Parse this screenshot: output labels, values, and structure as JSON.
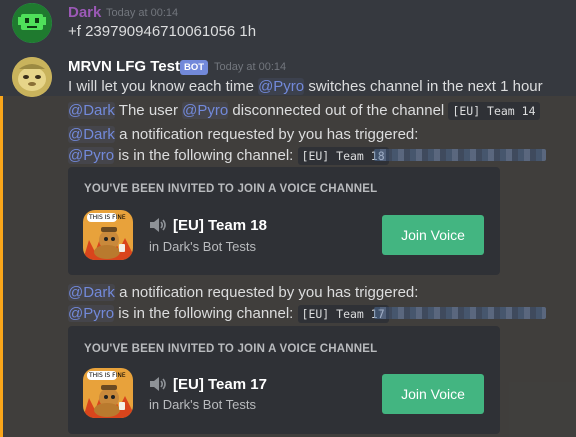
{
  "messages": {
    "first": {
      "author": "Dark",
      "timestamp": "Today at 00:14",
      "text": "+f 239790946710061056 1h"
    },
    "second": {
      "author": "MRVN LFG Tests",
      "badge": "BOT",
      "timestamp": "Today at 00:14",
      "line1_pre": "I will let you know each time ",
      "line1_mention": "@Pyro",
      "line1_post": " switches channel in the next 1 hour",
      "line2_mention": "@Dark",
      "line2_mid": " The user ",
      "line2_mention2": "@Pyro",
      "line2_post": " disconnected out of the channel ",
      "line2_code": "[EU] Team 14",
      "notif1_mention": "@Dark",
      "notif1_text": " a notification requested by you has triggered:",
      "notif1b_mention": "@Pyro",
      "notif1b_text": " is in the following channel: ",
      "notif1b_code": "[EU] Team 18",
      "notif2_mention": "@Dark",
      "notif2_text": " a notification requested by you has triggered:",
      "notif2b_mention": "@Pyro",
      "notif2b_text": " is in the following channel: ",
      "notif2b_code": "[EU] Team 17"
    }
  },
  "invites": [
    {
      "title": "You've been invited to join a voice channel",
      "channel": "[EU] Team 18",
      "guild": "in Dark's Bot Tests",
      "button": "Join Voice",
      "icon_caption": "THIS IS FINE"
    },
    {
      "title": "You've been invited to join a voice channel",
      "channel": "[EU] Team 17",
      "guild": "in Dark's Bot Tests",
      "button": "Join Voice",
      "icon_caption": "THIS IS FINE"
    }
  ],
  "colors": {
    "dark_name": "#9b59b6",
    "bot_name": "#ffffff",
    "mention": "#7289da",
    "button": "#43b581",
    "highlight": "#faa61a"
  }
}
